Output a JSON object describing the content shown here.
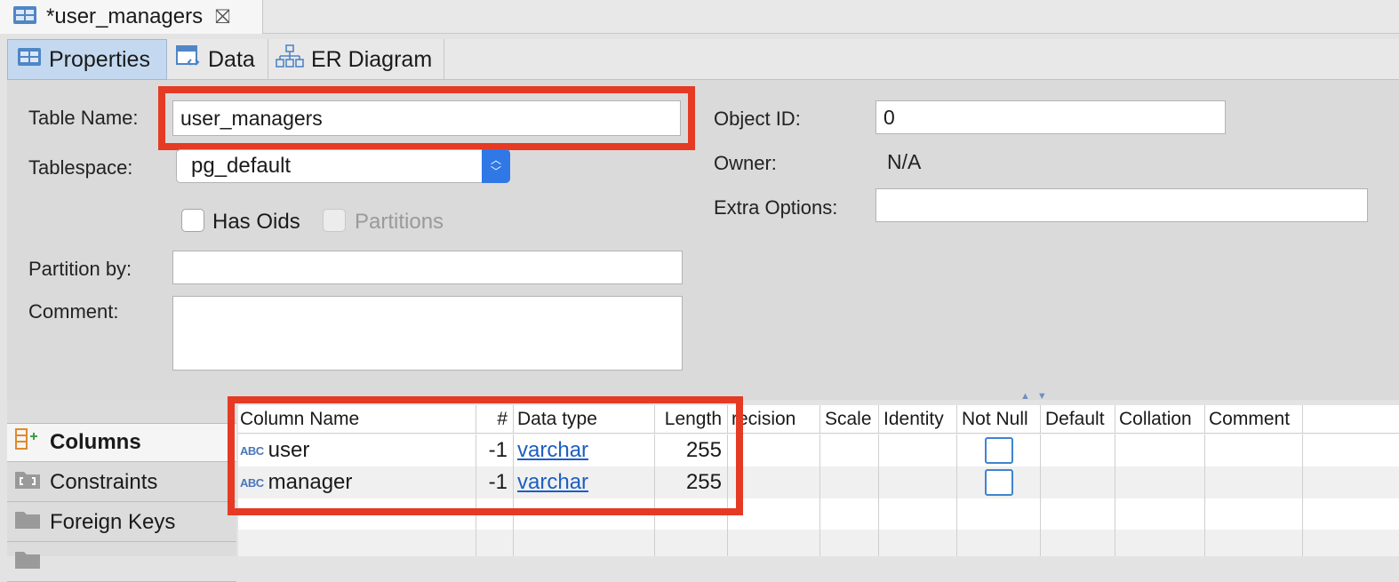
{
  "editor_tab": {
    "title": "*user_managers"
  },
  "subtabs": [
    {
      "label": "Properties"
    },
    {
      "label": "Data"
    },
    {
      "label": "ER Diagram"
    }
  ],
  "properties": {
    "table_name_label": "Table Name:",
    "table_name_value": "user_managers",
    "tablespace_label": "Tablespace:",
    "tablespace_value": "pg_default",
    "has_oids_label": "Has Oids",
    "partitions_label": "Partitions",
    "partition_by_label": "Partition by:",
    "partition_by_value": "",
    "comment_label": "Comment:",
    "comment_value": "",
    "object_id_label": "Object ID:",
    "object_id_value": "0",
    "owner_label": "Owner:",
    "owner_value": "N/A",
    "extra_options_label": "Extra Options:",
    "extra_options_value": ""
  },
  "side_nav": [
    {
      "label": "Columns"
    },
    {
      "label": "Constraints"
    },
    {
      "label": "Foreign Keys"
    }
  ],
  "columns_table": {
    "headers": [
      "Column Name",
      "#",
      "Data type",
      "Length",
      "recision",
      "Scale",
      "Identity",
      "Not Null",
      "Default",
      "Collation",
      "Comment"
    ],
    "rows": [
      {
        "name": "user",
        "num": "-1",
        "type": "varchar",
        "length": "255",
        "not_null": false
      },
      {
        "name": "manager",
        "num": "-1",
        "type": "varchar",
        "length": "255",
        "not_null": false
      }
    ]
  },
  "colors": {
    "highlight_red": "#e53a24",
    "accent_blue": "#2f78e6",
    "link_blue": "#1c5fc2"
  }
}
